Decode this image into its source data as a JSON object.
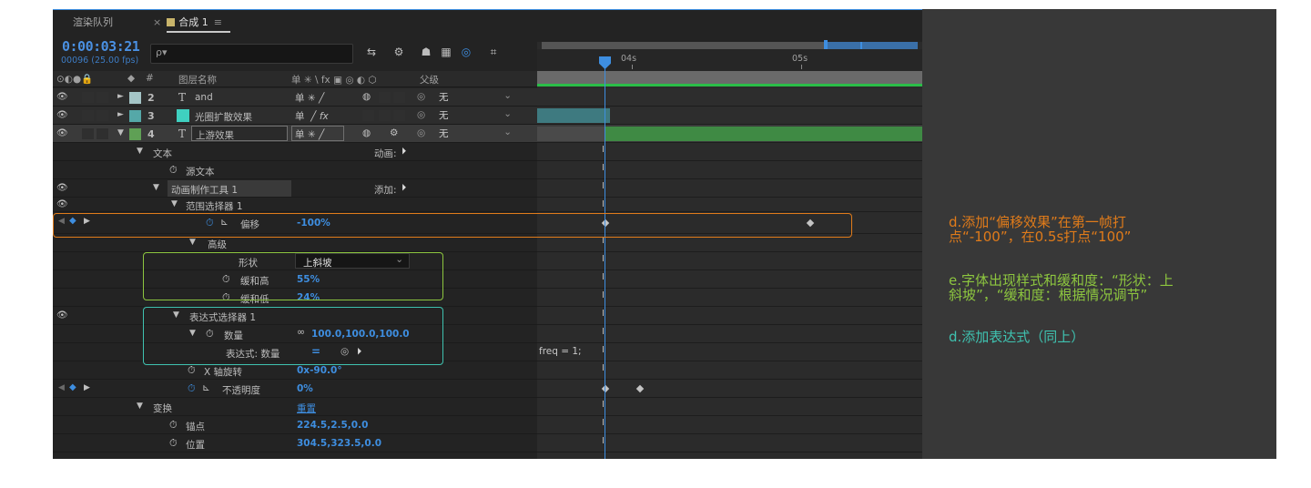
{
  "tabs": {
    "render_queue": "渲染队列",
    "close": "×",
    "comp": "合成 1",
    "menu": "≡"
  },
  "header": {
    "timecode": "0:00:03:21",
    "frames": "00096 (25.00 fps)",
    "search_icon": "ρ▾"
  },
  "columns": {
    "layer_name": "图层名称",
    "hash": "#",
    "parent": "父级",
    "switch_icons": "单 ✳ \\ fx ▣ ◎ ◐ ⬡"
  },
  "timeline": {
    "tick_04s": "04s",
    "tick_05s": "05s",
    "expression_text": "freq = 1;"
  },
  "layers": [
    {
      "num": "2",
      "type": "T",
      "name": "and",
      "parent": "无",
      "color": "#a5c5c7"
    },
    {
      "num": "3",
      "type": "",
      "name": "光圈扩散效果",
      "parent": "无",
      "color": "#55a8a8"
    },
    {
      "num": "4",
      "type": "T",
      "name": "上游效果",
      "parent": "无",
      "color": "#5fa055"
    }
  ],
  "props": {
    "text": "文本",
    "animate_label": "动画:",
    "source_text": "源文本",
    "animator": "动画制作工具 1",
    "add_label": "添加:",
    "range_selector": "范围选择器 1",
    "offset": "偏移",
    "offset_value": "-100%",
    "advanced": "高级",
    "shape": "形状",
    "shape_value": "上斜坡",
    "ease_high": "缓和高",
    "ease_high_value": "55%",
    "ease_low": "缓和低",
    "ease_low_value": "24%",
    "expr_selector": "表达式选择器 1",
    "amount": "数量",
    "amount_value": "100.0,100.0,100.0",
    "expr_amount": "表达式: 数量",
    "x_rotation": "X 轴旋转",
    "x_rotation_value": "0x-90.0°",
    "opacity": "不透明度",
    "opacity_value": "0%",
    "transform": "变换",
    "reset": "重置",
    "anchor": "锚点",
    "anchor_value": "224.5,2.5,0.0",
    "position": "位置",
    "position_value": "304.5,323.5,0.0"
  },
  "notes": {
    "note1_line1": "d.添加“偏移效果”在第一帧打",
    "note1_line2": "点“-100”，在0.5s打点“100”",
    "note2_line1": "e.字体出现样式和缓和度：“形状：上",
    "note2_line2": "斜坡”，“缓和度：根据情况调节”",
    "note3": "d.添加表达式（同上）"
  },
  "colors": {
    "accent_blue": "#3e8ee0",
    "orange": "#e07b1a",
    "green_note": "#8dc63f",
    "teal_note": "#3fc2b0",
    "green_bar": "#2bbd48"
  },
  "icons": [
    "eye-icon",
    "audio-icon",
    "solo-icon",
    "lock-icon",
    "label-icon",
    "stopwatch-icon",
    "graph-icon",
    "pickwhip-icon",
    "chain-link-icon",
    "play-icon",
    "keyframe-nav-icon"
  ]
}
